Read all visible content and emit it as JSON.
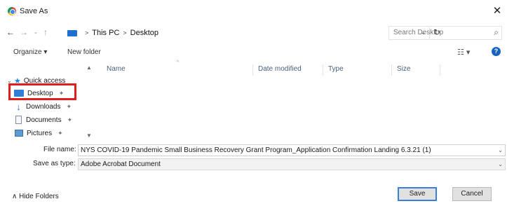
{
  "window": {
    "title": "Save As",
    "close_symbol": "✕"
  },
  "nav": {
    "back": "←",
    "forward": "→",
    "recent": "⌄",
    "up": "↑"
  },
  "address": {
    "crumbs": [
      "This PC",
      "Desktop"
    ],
    "separator": ">",
    "refresh": "↻",
    "dropdown": "⌄"
  },
  "search": {
    "placeholder": "Search Desktop",
    "icon": "⌕"
  },
  "commands": {
    "organize": "Organize ▾",
    "new_folder": "New folder",
    "view": "☷ ▾",
    "help": "?"
  },
  "navpane": {
    "quick_access": "Quick access",
    "items": [
      {
        "label": "Desktop",
        "pinned": true,
        "selected": true
      },
      {
        "label": "Downloads",
        "pinned": true
      },
      {
        "label": "Documents",
        "pinned": true
      },
      {
        "label": "Pictures",
        "pinned": true
      }
    ],
    "pin_symbol": "✦"
  },
  "columns": [
    "Name",
    "Date modified",
    "Type",
    "Size"
  ],
  "form": {
    "file_name_label": "File name:",
    "file_name_value": "NYS COVID-19 Pandemic Small Business Recovery Grant Program_Application Confirmation Landing 6.3.21 (1)",
    "save_type_label": "Save as type:",
    "save_type_value": "Adobe Acrobat Document"
  },
  "footer": {
    "hide_folders": "Hide Folders",
    "save": "Save",
    "cancel": "Cancel"
  },
  "colors": {
    "accent": "#1d6fd1",
    "highlight": "#e01e1e"
  }
}
